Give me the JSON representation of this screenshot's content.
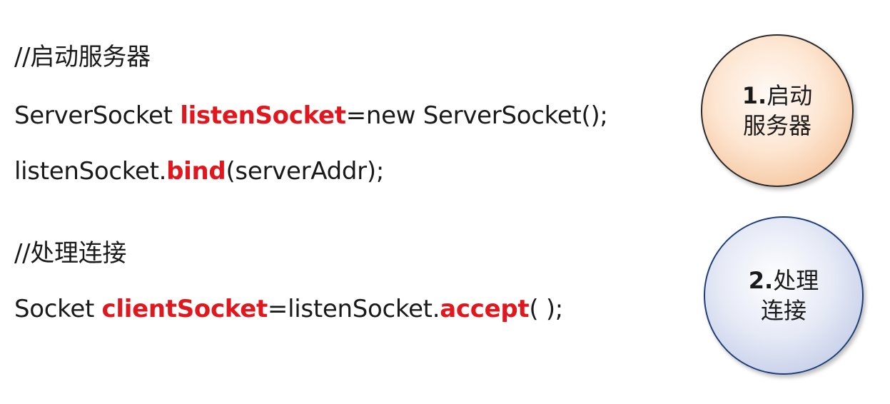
{
  "code": {
    "comment_start": "//启动服务器",
    "line1": {
      "pre": "ServerSocket ",
      "hl": "listenSocket",
      "post": "=new ServerSocket();"
    },
    "line2": {
      "pre": "listenSocket.",
      "hl": "bind",
      "post": "(serverAddr);"
    },
    "comment_process": "//处理连接",
    "line3": {
      "pre": "Socket ",
      "hl1": "clientSocket",
      "mid": "=listenSocket.",
      "hl2": "accept",
      "post": "( );"
    }
  },
  "steps": [
    {
      "num": "1.",
      "line1": "启动",
      "line2": "服务器"
    },
    {
      "num": "2.",
      "line1": "处理",
      "line2": "连接"
    }
  ],
  "colors": {
    "highlight": "#e2161d",
    "circle1": "#f6c7a1",
    "circle2": "#c6cfe9"
  }
}
